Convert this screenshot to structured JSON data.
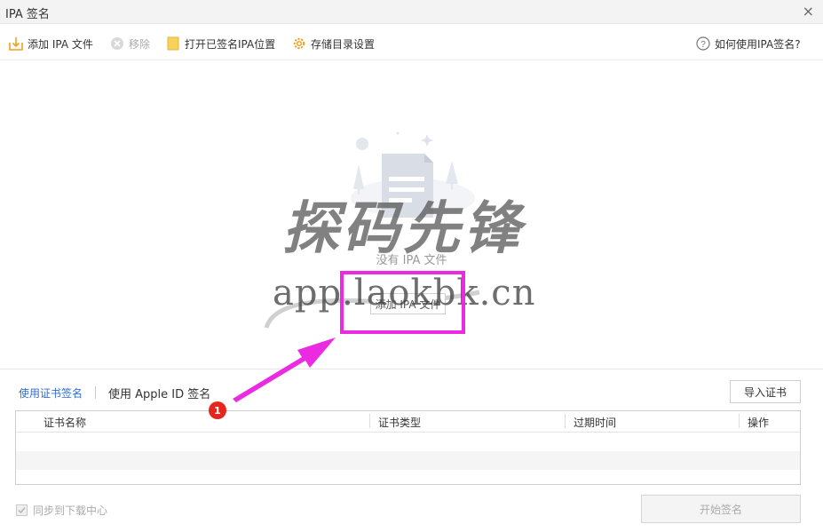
{
  "window": {
    "title": "IPA 签名",
    "close_glyph": "×"
  },
  "toolbar": {
    "add_ipa": "添加 IPA 文件",
    "remove": "移除",
    "open_signed": "打开已签名IPA位置",
    "storage_settings": "存储目录设置",
    "help": "如何使用IPA签名?"
  },
  "empty": {
    "message": "没有 IPA 文件",
    "add_button": "添加 IPA 文件"
  },
  "watermark": {
    "text_cn": "探码先锋",
    "url": "app.laokbk.cn"
  },
  "tabs": {
    "cert_sign": "使用证书签名",
    "apple_id_sign": "使用 Apple ID 签名"
  },
  "import_cert": "导入证书",
  "table": {
    "headers": [
      "证书名称",
      "证书类型",
      "过期时间",
      "操作"
    ],
    "rows": []
  },
  "footer": {
    "sync_label": "同步到下载中心",
    "start_sign": "开始签名"
  },
  "annotation": {
    "badge": "1"
  },
  "colors": {
    "accent": "#2f6fd1",
    "highlight": "#ea2be2",
    "badge": "#e5261f",
    "icon_orange": "#f0a020"
  }
}
